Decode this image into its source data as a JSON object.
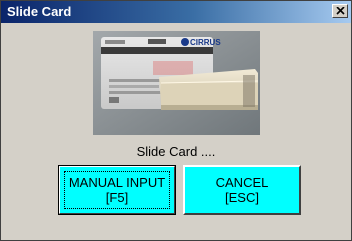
{
  "window": {
    "title": "Slide Card"
  },
  "image": {
    "card_brand_text": "CIRRUS",
    "reader": "card-reader"
  },
  "status": {
    "text": "Slide Card ...."
  },
  "buttons": {
    "manual": {
      "line1": "MANUAL INPUT",
      "line2": "[F5]"
    },
    "cancel": {
      "line1": "CANCEL",
      "line2": "[ESC]"
    }
  },
  "colors": {
    "button_bg": "#00ffff",
    "title_bg": "#0a246a",
    "window_bg": "#d4d0c8"
  }
}
